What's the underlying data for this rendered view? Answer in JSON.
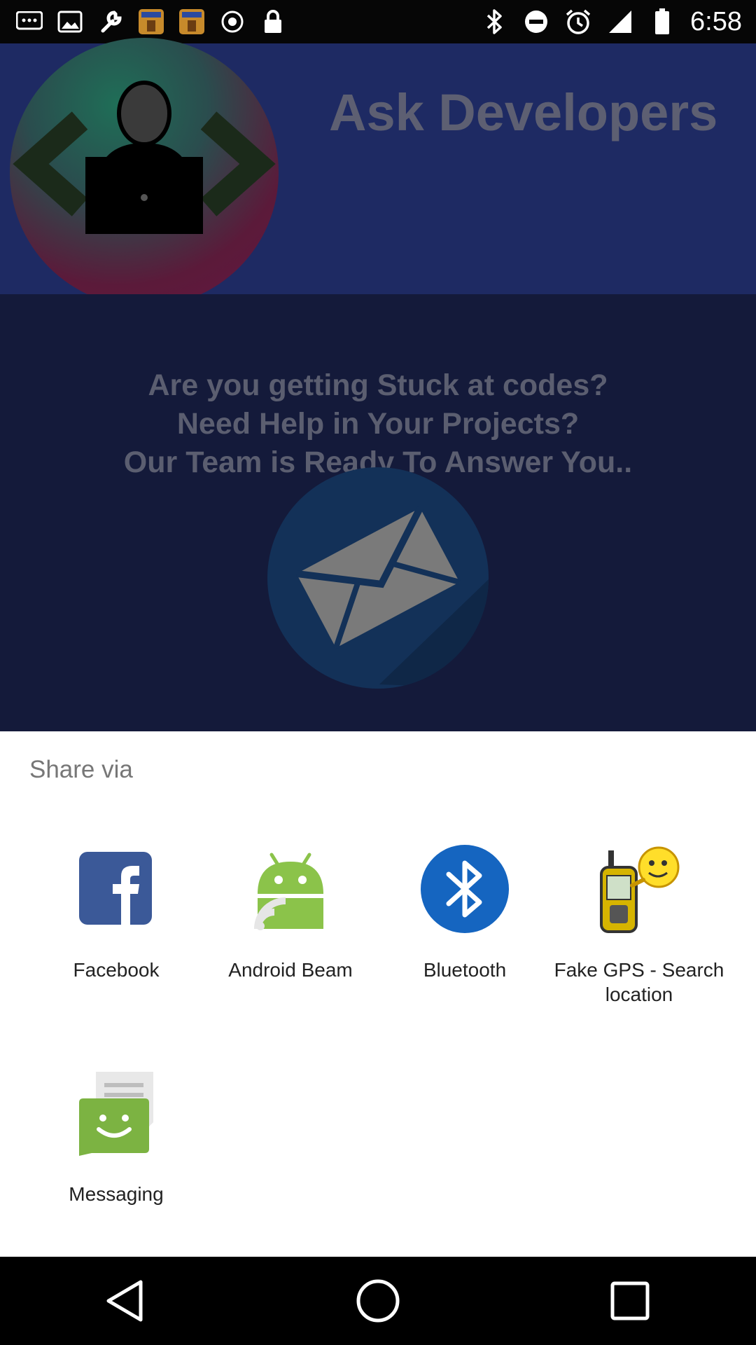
{
  "status_bar": {
    "time": "6:58",
    "notification_icons": [
      "messages-icon",
      "image-icon",
      "wrench-icon",
      "topics-app-icon",
      "topics-app-icon",
      "record-icon",
      "lock-icon"
    ],
    "system_icons": [
      "bluetooth-icon",
      "do-not-disturb-icon",
      "alarm-icon",
      "signal-icon",
      "battery-icon"
    ]
  },
  "app": {
    "title": "Ask Developers",
    "tagline_lines": [
      "Are you getting Stuck at codes?",
      "Need Help in Your Projects?",
      "Our Team is Ready To Answer You.."
    ]
  },
  "share_sheet": {
    "title": "Share via",
    "apps": [
      {
        "label": "Facebook",
        "icon": "facebook-icon"
      },
      {
        "label": "Android Beam",
        "icon": "android-beam-icon"
      },
      {
        "label": "Bluetooth",
        "icon": "bluetooth-icon"
      },
      {
        "label": "Fake GPS - Search location",
        "icon": "fake-gps-icon"
      },
      {
        "label": "Messaging",
        "icon": "messaging-icon"
      }
    ]
  },
  "nav_bar": {
    "buttons": [
      "back-icon",
      "home-icon",
      "recents-icon"
    ]
  },
  "colors": {
    "facebook": "#3b5998",
    "android_green": "#8bc34a",
    "bluetooth_blue": "#1565c0",
    "app_header": "#1e2a63",
    "app_body": "#141a3a"
  }
}
